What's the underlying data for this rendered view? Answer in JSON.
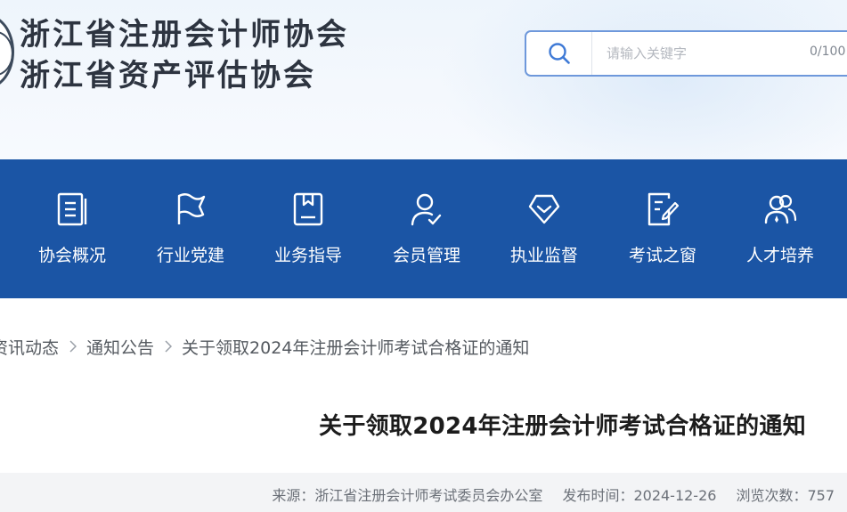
{
  "header": {
    "org_name_1": "浙江省注册会计师协会",
    "org_name_2": "浙江省资产评估协会",
    "search": {
      "placeholder": "请输入关键字",
      "counter": "0/100",
      "icon": "search-icon"
    }
  },
  "nav": {
    "items": [
      {
        "label": "协会概况",
        "icon": "document-icon"
      },
      {
        "label": "行业党建",
        "icon": "flag-icon"
      },
      {
        "label": "业务指导",
        "icon": "bookmark-file-icon"
      },
      {
        "label": "会员管理",
        "icon": "user-check-icon"
      },
      {
        "label": "执业监督",
        "icon": "shield-check-icon"
      },
      {
        "label": "考试之窗",
        "icon": "edit-document-icon"
      },
      {
        "label": "人才培养",
        "icon": "users-icon"
      }
    ]
  },
  "breadcrumb": {
    "items": [
      "资讯动态",
      "通知公告",
      "关于领取2024年注册会计师考试合格证的通知"
    ],
    "separator_icon": "chevron-right-icon"
  },
  "article": {
    "title": "关于领取2024年注册会计师考试合格证的通知",
    "source_label": "来源：",
    "source": "浙江省注册会计师考试委员会办公室",
    "date_label": "发布时间：",
    "date": "2024-12-26",
    "views_label": "浏览次数：",
    "views": "757"
  },
  "colors": {
    "nav_bg": "#1b55a5",
    "search_border": "#6e98db",
    "header_bg": "#eef5fc"
  }
}
